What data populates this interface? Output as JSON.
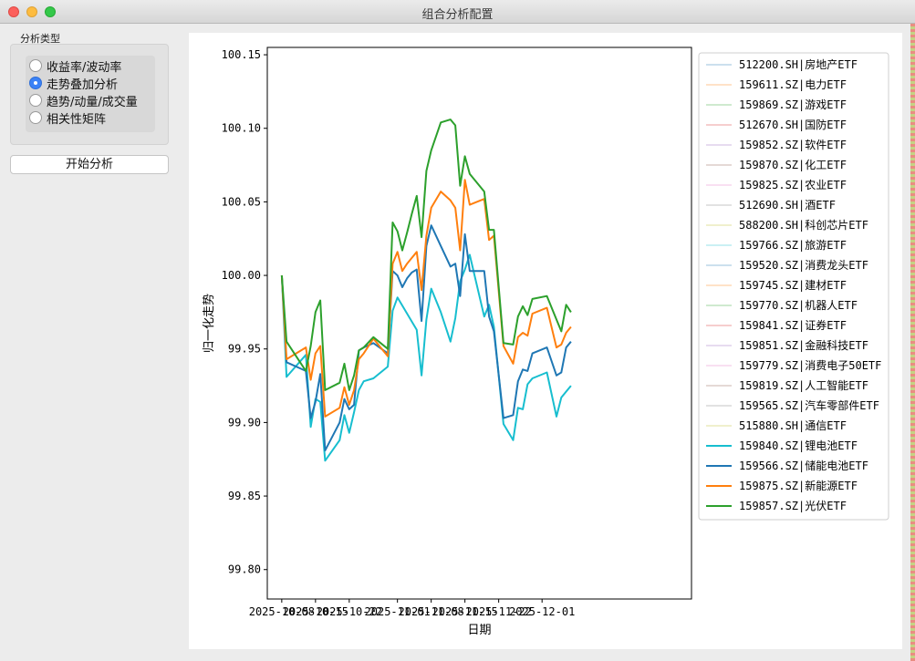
{
  "window": {
    "title": "组合分析配置"
  },
  "sidebar": {
    "group_title": "分析类型",
    "options": [
      {
        "label": "收益率/波动率",
        "selected": false
      },
      {
        "label": "走势叠加分析",
        "selected": true
      },
      {
        "label": "趋势/动量/成交量",
        "selected": false
      },
      {
        "label": "相关性矩阵",
        "selected": false
      }
    ],
    "start_button": "开始分析"
  },
  "chart_data": {
    "type": "line",
    "xlabel": "日期",
    "ylabel": "归一化走势",
    "ylim": [
      99.78,
      100.155
    ],
    "xlim": [
      -3,
      85
    ],
    "y_ticks": [
      "100.15",
      "100.10",
      "100.05",
      "100.00",
      "99.95",
      "99.90",
      "99.85",
      "99.80"
    ],
    "y_tick_values": [
      100.15,
      100.1,
      100.05,
      100.0,
      99.95,
      99.9,
      99.85,
      99.8
    ],
    "x_ticks": [
      "2025-10-08",
      "2025-10-15",
      "2025-10-22",
      "2025-11-01",
      "2025-11-08",
      "2025-11-15",
      "2025-11-22",
      "2025-12-01"
    ],
    "x_tick_values": [
      0,
      7,
      14,
      24,
      31,
      38,
      45,
      54
    ],
    "legend_position": "right",
    "grid": false,
    "series": [
      {
        "name": "512200.SH|房地产ETF",
        "color": "#1f77b4",
        "faded": true,
        "values": []
      },
      {
        "name": "159611.SZ|电力ETF",
        "color": "#ff7f0e",
        "faded": true,
        "values": []
      },
      {
        "name": "159869.SZ|游戏ETF",
        "color": "#2ca02c",
        "faded": true,
        "values": []
      },
      {
        "name": "512670.SH|国防ETF",
        "color": "#d62728",
        "faded": true,
        "values": []
      },
      {
        "name": "159852.SZ|软件ETF",
        "color": "#9467bd",
        "faded": true,
        "values": []
      },
      {
        "name": "159870.SZ|化工ETF",
        "color": "#8c564b",
        "faded": true,
        "values": []
      },
      {
        "name": "159825.SZ|农业ETF",
        "color": "#e377c2",
        "faded": true,
        "values": []
      },
      {
        "name": "512690.SH|酒ETF",
        "color": "#7f7f7f",
        "faded": true,
        "values": []
      },
      {
        "name": "588200.SH|科创芯片ETF",
        "color": "#bcbd22",
        "faded": true,
        "values": []
      },
      {
        "name": "159766.SZ|旅游ETF",
        "color": "#17becf",
        "faded": true,
        "values": []
      },
      {
        "name": "159520.SZ|消费龙头ETF",
        "color": "#1f77b4",
        "faded": true,
        "values": []
      },
      {
        "name": "159745.SZ|建材ETF",
        "color": "#ff7f0e",
        "faded": true,
        "values": []
      },
      {
        "name": "159770.SZ|机器人ETF",
        "color": "#2ca02c",
        "faded": true,
        "values": []
      },
      {
        "name": "159841.SZ|证券ETF",
        "color": "#d62728",
        "faded": true,
        "values": []
      },
      {
        "name": "159851.SZ|金融科技ETF",
        "color": "#9467bd",
        "faded": true,
        "values": []
      },
      {
        "name": "159779.SZ|消费电子50ETF",
        "color": "#e377c2",
        "faded": true,
        "values": []
      },
      {
        "name": "159819.SZ|人工智能ETF",
        "color": "#8c564b",
        "faded": true,
        "values": []
      },
      {
        "name": "159565.SZ|汽车零部件ETF",
        "color": "#7f7f7f",
        "faded": true,
        "values": []
      },
      {
        "name": "515880.SH|通信ETF",
        "color": "#bcbd22",
        "faded": true,
        "values": []
      },
      {
        "name": "159840.SZ|锂电池ETF",
        "color": "#17becf",
        "faded": false,
        "x": [
          0,
          1,
          5,
          6,
          7,
          8,
          9,
          12,
          13,
          14,
          15,
          16,
          17,
          19,
          22,
          23,
          24,
          28,
          29,
          30,
          31,
          33,
          35,
          36,
          37,
          38,
          39,
          42,
          43,
          44,
          46,
          48,
          49,
          50,
          51,
          52,
          55,
          57,
          58,
          59,
          60
        ],
        "values": [
          100.0,
          99.931,
          99.946,
          99.897,
          99.916,
          99.914,
          99.874,
          99.888,
          99.905,
          99.893,
          99.907,
          99.922,
          99.928,
          99.93,
          99.938,
          99.976,
          99.985,
          99.963,
          99.932,
          99.97,
          99.991,
          99.975,
          99.955,
          99.971,
          99.996,
          100.004,
          100.014,
          99.972,
          99.98,
          99.965,
          99.899,
          99.888,
          99.91,
          99.909,
          99.926,
          99.93,
          99.934,
          99.904,
          99.917,
          99.921,
          99.925
        ]
      },
      {
        "name": "159566.SZ|储能电池ETF",
        "color": "#1f77b4",
        "faded": false,
        "x": [
          0,
          1,
          5,
          6,
          7,
          8,
          9,
          12,
          13,
          14,
          15,
          16,
          17,
          19,
          22,
          23,
          24,
          25,
          26,
          27,
          28,
          29,
          30,
          31,
          33,
          35,
          36,
          37,
          38,
          39,
          42,
          43,
          44,
          46,
          48,
          49,
          50,
          51,
          52,
          55,
          57,
          58,
          59,
          60
        ],
        "values": [
          100.0,
          99.941,
          99.935,
          99.903,
          99.914,
          99.933,
          99.881,
          99.9,
          99.916,
          99.909,
          99.912,
          99.949,
          99.951,
          99.954,
          99.947,
          100.003,
          100.0,
          99.992,
          99.998,
          100.002,
          100.004,
          99.969,
          100.02,
          100.034,
          100.02,
          100.006,
          100.008,
          99.986,
          100.028,
          100.003,
          100.003,
          99.972,
          99.962,
          99.903,
          99.905,
          99.928,
          99.936,
          99.935,
          99.947,
          99.951,
          99.932,
          99.934,
          99.951,
          99.955
        ]
      },
      {
        "name": "159875.SZ|新能源ETF",
        "color": "#ff7f0e",
        "faded": false,
        "x": [
          0,
          1,
          5,
          6,
          7,
          8,
          9,
          12,
          13,
          14,
          15,
          16,
          17,
          19,
          22,
          23,
          24,
          25,
          26,
          27,
          28,
          29,
          30,
          31,
          33,
          35,
          36,
          37,
          38,
          39,
          42,
          43,
          44,
          46,
          48,
          49,
          50,
          51,
          52,
          55,
          57,
          58,
          59,
          60
        ],
        "values": [
          100.0,
          99.943,
          99.951,
          99.929,
          99.947,
          99.952,
          99.904,
          99.91,
          99.924,
          99.912,
          99.922,
          99.943,
          99.947,
          99.957,
          99.945,
          100.008,
          100.016,
          100.003,
          100.008,
          100.012,
          100.016,
          99.99,
          100.027,
          100.046,
          100.057,
          100.051,
          100.046,
          100.017,
          100.065,
          100.048,
          100.052,
          100.024,
          100.027,
          99.952,
          99.94,
          99.958,
          99.961,
          99.959,
          99.974,
          99.978,
          99.951,
          99.953,
          99.961,
          99.965
        ]
      },
      {
        "name": "159857.SZ|光伏ETF",
        "color": "#2ca02c",
        "faded": false,
        "x": [
          0,
          1,
          5,
          6,
          7,
          8,
          9,
          12,
          13,
          14,
          15,
          16,
          17,
          19,
          22,
          23,
          24,
          25,
          26,
          27,
          28,
          29,
          30,
          31,
          33,
          35,
          36,
          37,
          38,
          39,
          42,
          43,
          44,
          46,
          48,
          49,
          50,
          51,
          52,
          55,
          57,
          58,
          59,
          60
        ],
        "values": [
          100.0,
          99.955,
          99.935,
          99.952,
          99.975,
          99.983,
          99.922,
          99.927,
          99.94,
          99.922,
          99.932,
          99.949,
          99.951,
          99.958,
          99.95,
          100.036,
          100.03,
          100.017,
          100.029,
          100.042,
          100.054,
          100.026,
          100.071,
          100.085,
          100.104,
          100.106,
          100.102,
          100.061,
          100.081,
          100.069,
          100.057,
          100.031,
          100.031,
          99.954,
          99.953,
          99.972,
          99.979,
          99.973,
          99.984,
          99.986,
          99.97,
          99.962,
          99.98,
          99.975
        ]
      }
    ]
  }
}
